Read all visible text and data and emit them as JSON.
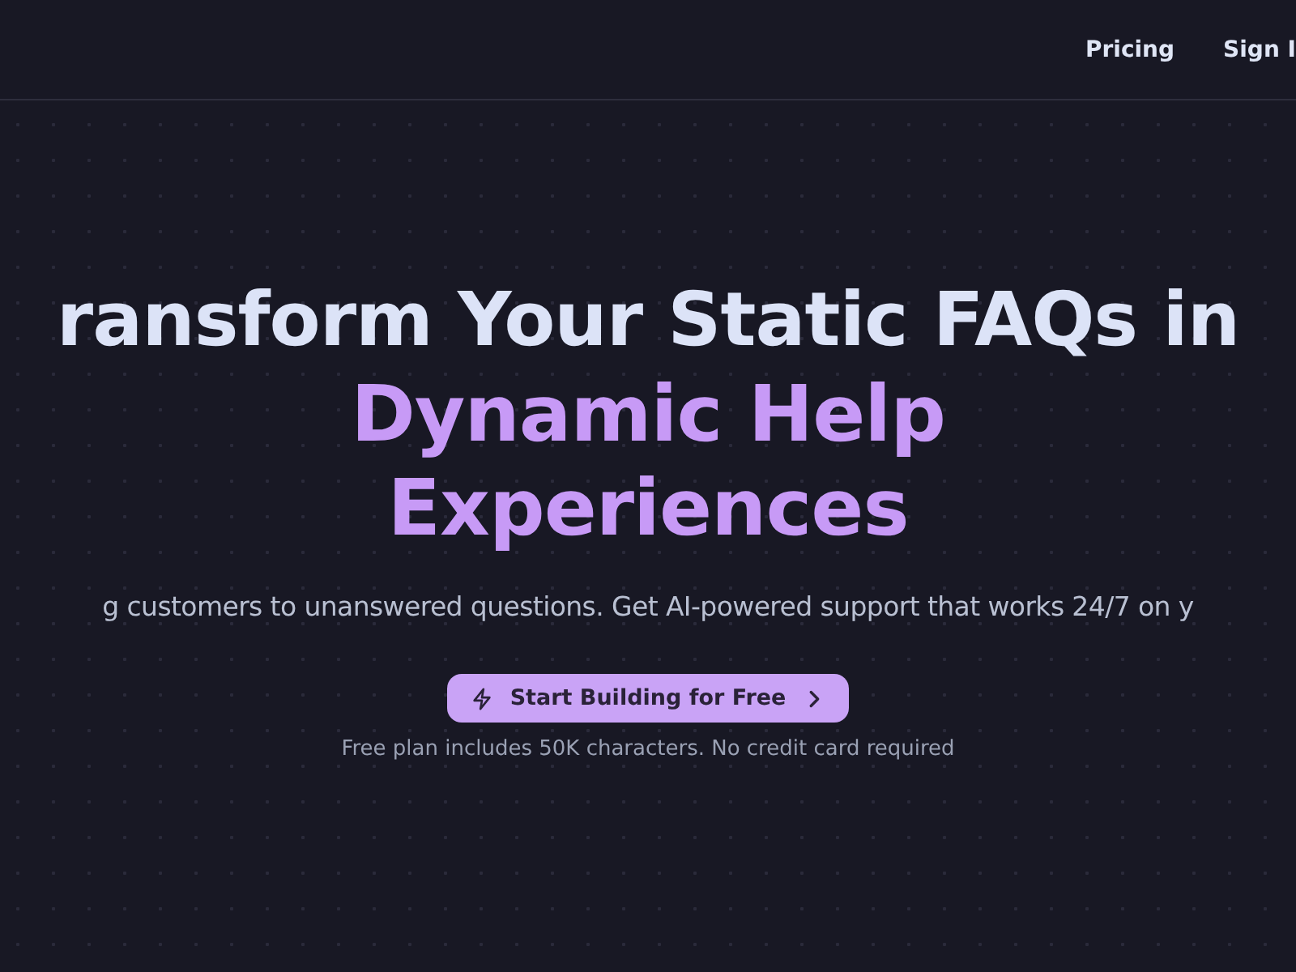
{
  "nav": {
    "links": [
      {
        "label": "Pricing"
      },
      {
        "label": "Sign I"
      }
    ]
  },
  "hero": {
    "headline": "ransform Your Static FAQs in",
    "headline_accent": [
      "Dynamic Help",
      "Experiences"
    ],
    "subtitle": "g customers to unanswered questions. Get AI-powered support that works 24/7 on y",
    "cta": {
      "label": "Start Building for Free"
    },
    "note": "Free plan includes 50K characters. No credit card required"
  }
}
